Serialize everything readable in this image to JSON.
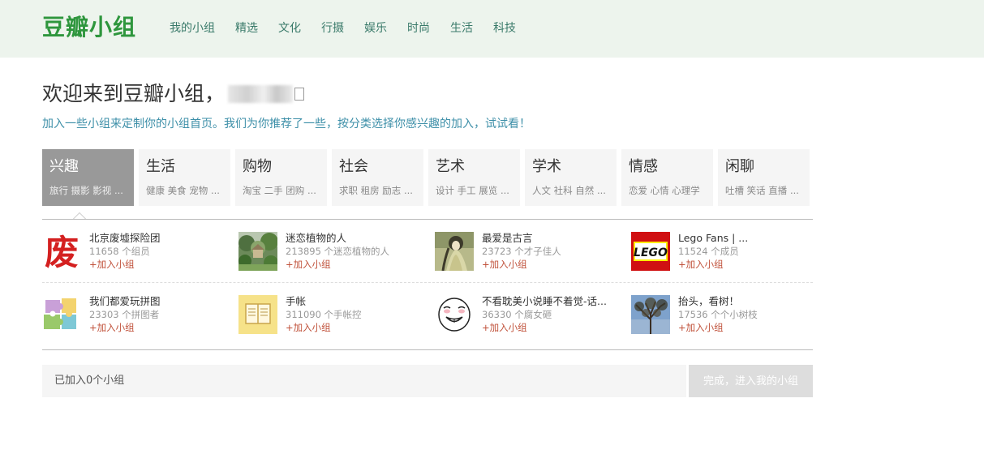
{
  "header": {
    "logo": "豆瓣小组",
    "nav": [
      "我的小组",
      "精选",
      "文化",
      "行摄",
      "娱乐",
      "时尚",
      "生活",
      "科技"
    ]
  },
  "welcome": {
    "text": "欢迎来到豆瓣小组，",
    "intro": "加入一些小组来定制你的小组首页。我们为你推荐了一些，按分类选择你感兴趣的加入，试试看！"
  },
  "categories": [
    {
      "title": "兴趣",
      "sub": "旅行 摄影 影视 ...",
      "active": true
    },
    {
      "title": "生活",
      "sub": "健康 美食 宠物 ...",
      "active": false
    },
    {
      "title": "购物",
      "sub": "淘宝 二手 团购 ...",
      "active": false
    },
    {
      "title": "社会",
      "sub": "求职 租房 励志 ...",
      "active": false
    },
    {
      "title": "艺术",
      "sub": "设计 手工 展览 ...",
      "active": false
    },
    {
      "title": "学术",
      "sub": "人文 社科 自然 ...",
      "active": false
    },
    {
      "title": "情感",
      "sub": "恋爱 心情 心理学",
      "active": false
    },
    {
      "title": "闲聊",
      "sub": "吐槽 笑话 直播 ...",
      "active": false
    }
  ],
  "groups": [
    {
      "name": "北京废墟探险团",
      "count": "11658 个组员",
      "join": "+加入小组",
      "thumb": "ruins-logo"
    },
    {
      "name": "迷恋植物的人",
      "count": "213895 个迷恋植物的人",
      "join": "+加入小组",
      "thumb": "garden-photo"
    },
    {
      "name": "最爱是古言",
      "count": "23723 个才子佳人",
      "join": "+加入小组",
      "thumb": "ancient-illustration"
    },
    {
      "name": "Lego Fans | ...",
      "count": "11524 个成员",
      "join": "+加入小组",
      "thumb": "lego-logo"
    },
    {
      "name": "我们都爱玩拼图",
      "count": "23303 个拼图者",
      "join": "+加入小组",
      "thumb": "puzzle-pieces"
    },
    {
      "name": "手帐",
      "count": "311090 个手帐控",
      "join": "+加入小组",
      "thumb": "notebook-icon"
    },
    {
      "name": "不看耽美小说睡不着觉-话...",
      "count": "36330 个腐女砸",
      "join": "+加入小组",
      "thumb": "meme-face"
    },
    {
      "name": "抬头，看树！",
      "count": "17536 个个小树枝",
      "join": "+加入小组",
      "thumb": "tree-photo"
    }
  ],
  "thumb_text": {
    "ruins": "废",
    "lego": "LEGO"
  },
  "footer": {
    "joined_count": "已加入0个小组",
    "finish": "完成，进入我的小组"
  },
  "colors": {
    "brand": "#2e963d",
    "header_bg": "#edf4ed",
    "intro_text": "#3d8fa8",
    "join_link": "#c0513a",
    "active_tab": "#999999"
  }
}
